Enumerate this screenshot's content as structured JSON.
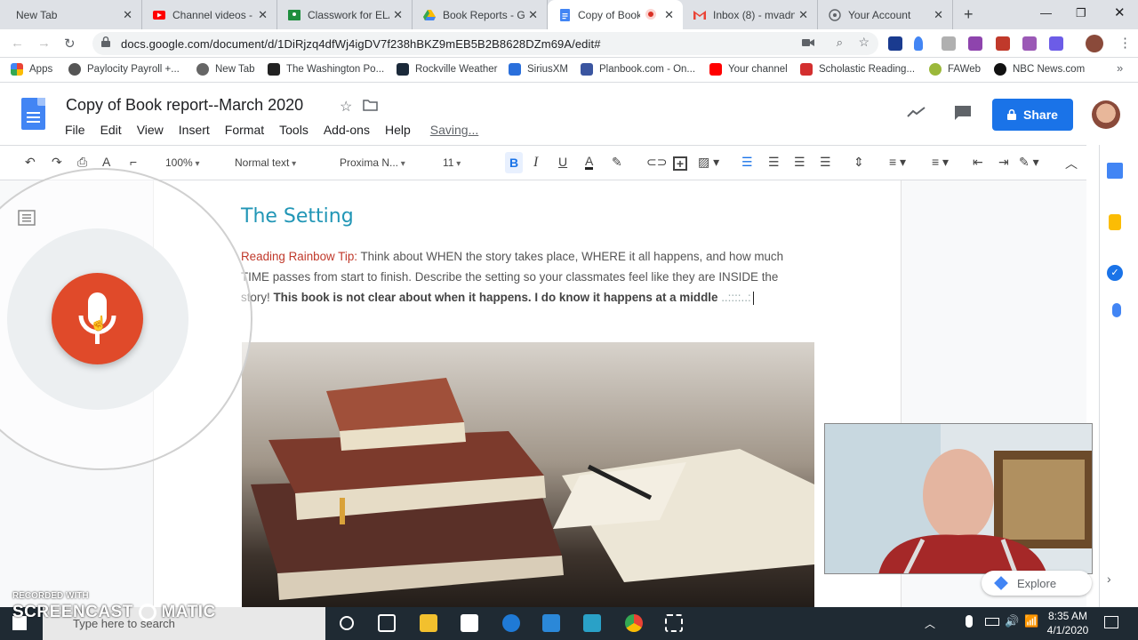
{
  "tabs": [
    {
      "label": "New Tab",
      "icon": "none"
    },
    {
      "label": "Channel videos - Y",
      "icon": "youtube-icon"
    },
    {
      "label": "Classwork for ELA",
      "icon": "classroom-icon"
    },
    {
      "label": "Book Reports - Go",
      "icon": "drive-icon"
    },
    {
      "label": "Copy of Book",
      "icon": "docs-icon"
    },
    {
      "label": "Inbox (8) - mvadn",
      "icon": "gmail-icon"
    },
    {
      "label": "Your Account",
      "icon": "account-icon"
    }
  ],
  "address": {
    "url": "docs.google.com/document/d/1DiRjzq4dfWj4igDV7f238hBKZ9mEB5B2B8628DZm69A/edit#"
  },
  "bookmarks": [
    {
      "label": "Apps"
    },
    {
      "label": "Paylocity Payroll +..."
    },
    {
      "label": "New Tab"
    },
    {
      "label": "The Washington Po..."
    },
    {
      "label": "Rockville Weather"
    },
    {
      "label": "SiriusXM"
    },
    {
      "label": "Planbook.com - On..."
    },
    {
      "label": "Your channel"
    },
    {
      "label": "Scholastic Reading..."
    },
    {
      "label": "FAWeb"
    },
    {
      "label": "NBC News.com"
    }
  ],
  "doc": {
    "title": "Copy of Book report--March 2020",
    "menu": [
      "File",
      "Edit",
      "View",
      "Insert",
      "Format",
      "Tools",
      "Add-ons",
      "Help"
    ],
    "status": "Saving...",
    "share_label": "Share"
  },
  "toolbar": {
    "zoom": "100%",
    "style": "Normal text",
    "font": "Proxima N...",
    "size": "11"
  },
  "content": {
    "heading": "The Setting",
    "tip_label": "Reading Rainbow Tip:",
    "tip_text": " Think about WHEN the story takes place, WHERE it all happens, and how much TIME passes from start to finish. Describe the setting so your classmates feel like they are INSIDE the story!  ",
    "answer": "This book is not clear about when it happens. I do know it happens at a middle",
    "interim": "..::::..:"
  },
  "explore_label": "Explore",
  "taskbar": {
    "search_placeholder": "Type here to search",
    "time": "8:35 AM",
    "date": "4/1/2020"
  },
  "watermark": {
    "line1": "RECORDED WITH",
    "line2": "SCREENCAST",
    "line3": "MATIC"
  },
  "colors": {
    "accent": "#1a73e8",
    "mic": "#e04a2a",
    "heading": "#2196b6",
    "tip": "#c0392b"
  }
}
